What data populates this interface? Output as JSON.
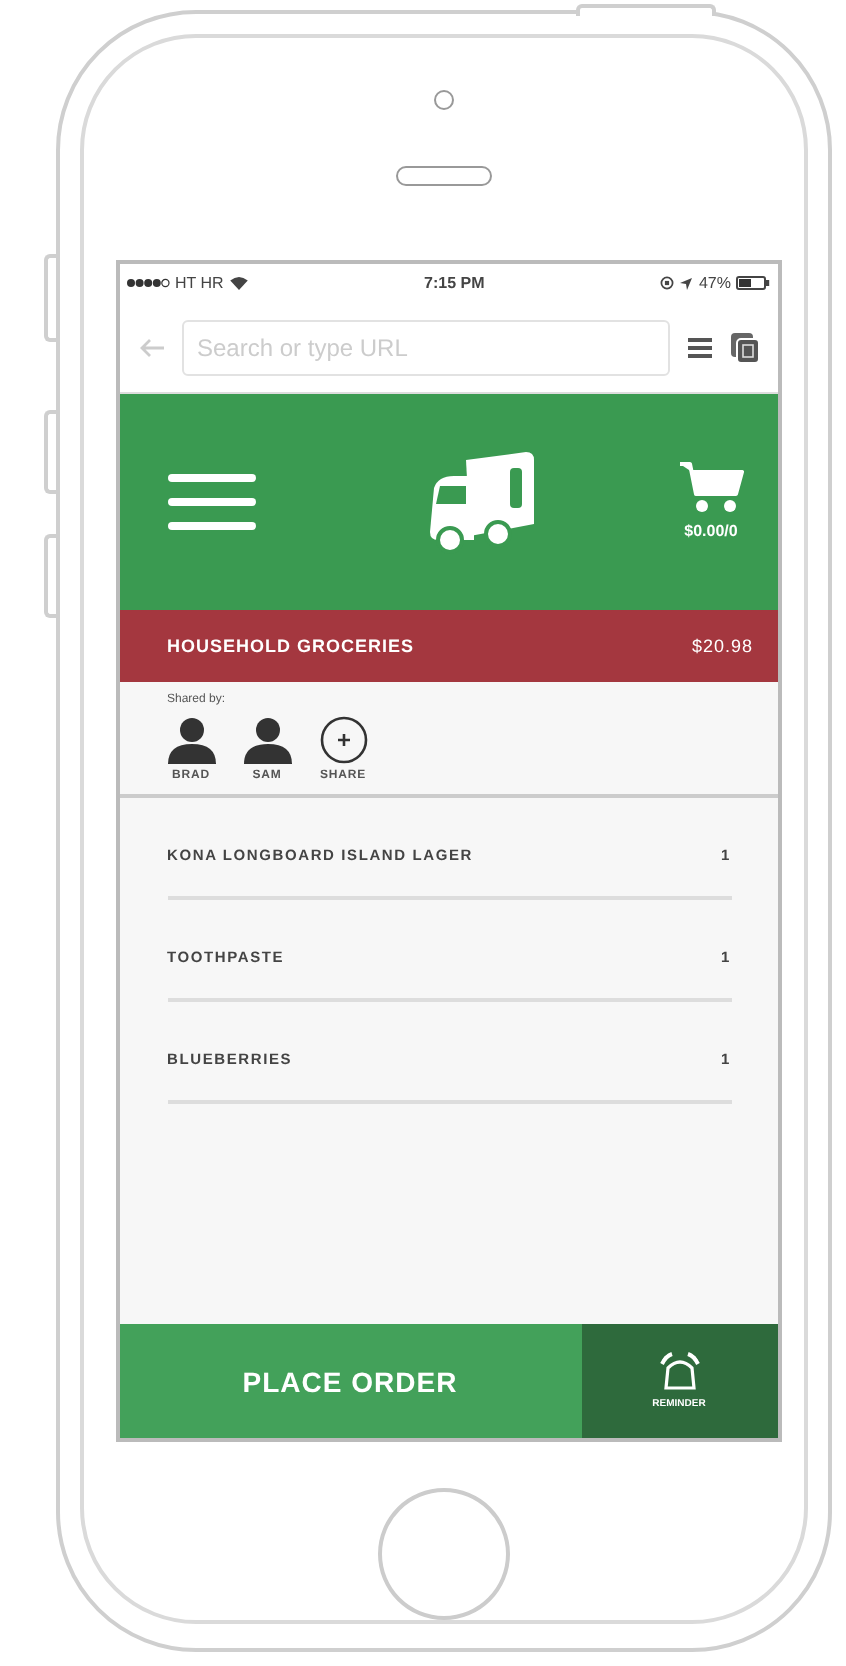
{
  "status_bar": {
    "carrier": "HT HR",
    "time": "7:15 PM",
    "battery": "47%"
  },
  "browser_bar": {
    "placeholder": "Search or type URL"
  },
  "header": {
    "cart_total": "$0.00/0"
  },
  "list_bar": {
    "title": "HOUSEHOLD GROCERIES",
    "total": "$20.98"
  },
  "shared": {
    "label": "Shared by:",
    "people": [
      {
        "kind": "person",
        "name": "BRAD"
      },
      {
        "kind": "person",
        "name": "SAM"
      },
      {
        "kind": "add",
        "name": "SHARE"
      }
    ]
  },
  "items": [
    {
      "name": "KONA LONGBOARD ISLAND LAGER",
      "qty": "1"
    },
    {
      "name": "TOOTHPASTE",
      "qty": "1"
    },
    {
      "name": "BLUEBERRIES",
      "qty": "1"
    }
  ],
  "footer": {
    "order": "PLACE ORDER",
    "reminder": "REMINDER"
  }
}
